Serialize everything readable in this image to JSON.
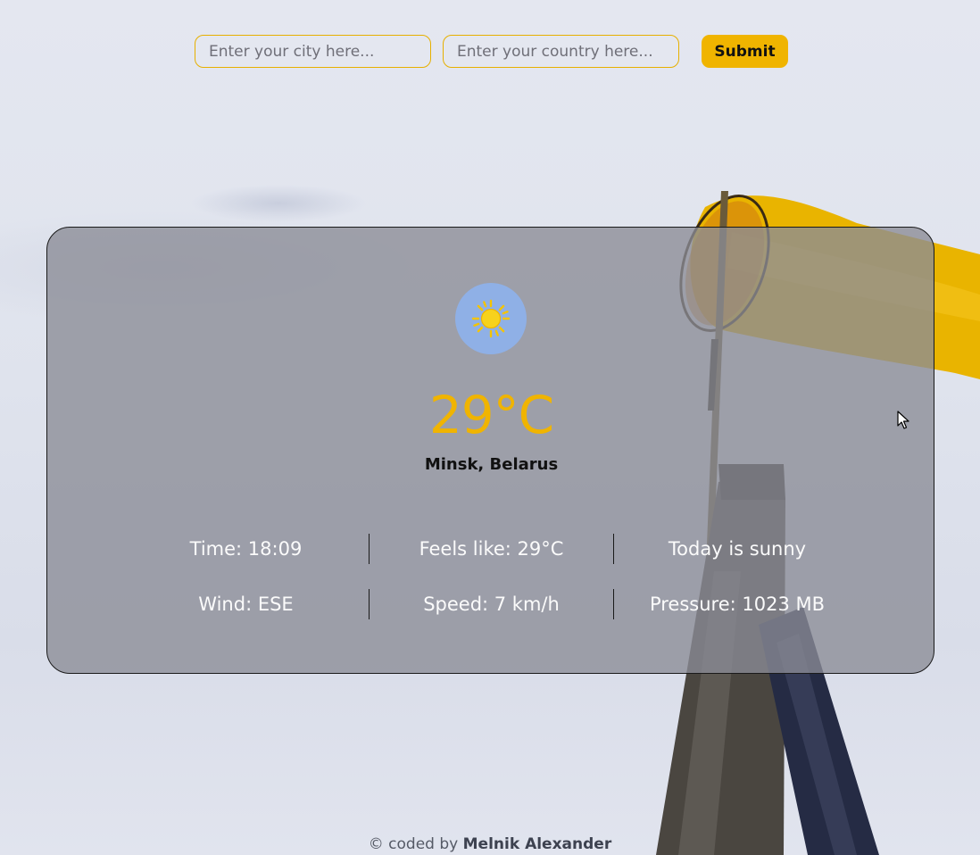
{
  "search": {
    "city_placeholder": "Enter your city here...",
    "country_placeholder": "Enter your country here...",
    "submit_label": "Submit"
  },
  "weather": {
    "icon": "sun-icon",
    "temperature": "29°C",
    "location": "Minsk, Belarus",
    "time": "Time: 18:09",
    "feels_like": "Feels like: 29°C",
    "description": "Today is sunny",
    "wind": "Wind: ESE",
    "speed": "Speed: 7 km/h",
    "pressure": "Pressure: 1023 MB"
  },
  "footer": {
    "prefix": "© coded by ",
    "author": "Melnik Alexander"
  },
  "colors": {
    "accent": "#f0b400",
    "card_background": "rgba(138,140,150,0.78)",
    "icon_circle": "#8fb0e6"
  }
}
